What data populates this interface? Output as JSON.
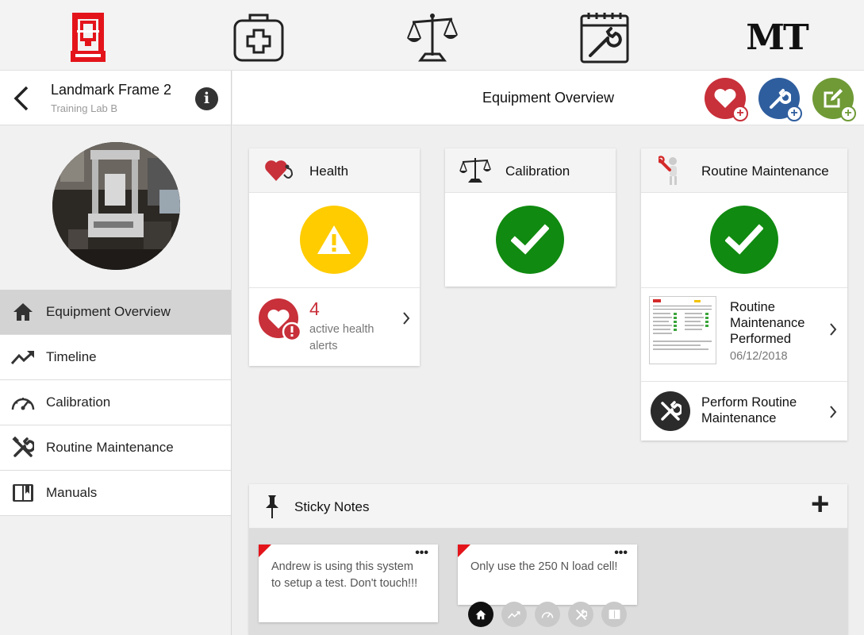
{
  "topbar": {
    "icons": [
      "frame-machine-icon",
      "first-aid-kit-icon",
      "balance-scale-icon",
      "calendar-wrench-icon"
    ],
    "logo_text": "MT"
  },
  "sidebar": {
    "title": "Landmark Frame 2",
    "subtitle": "Training Lab B",
    "info_glyph": "i",
    "nav": [
      {
        "label": "Equipment Overview",
        "icon": "home-icon",
        "active": true
      },
      {
        "label": "Timeline",
        "icon": "trend-icon"
      },
      {
        "label": "Calibration",
        "icon": "gauge-icon"
      },
      {
        "label": "Routine Maintenance",
        "icon": "tools-icon"
      },
      {
        "label": "Manuals",
        "icon": "book-icon"
      }
    ]
  },
  "header": {
    "title": "Equipment Overview",
    "colors": {
      "health": "#c8303a",
      "maintenance": "#2f5e9e",
      "edit": "#6f9a36"
    }
  },
  "health": {
    "title": "Health",
    "status": "warning",
    "status_color": "#ffcc00",
    "alert_count": "4",
    "alert_text": "active health alerts"
  },
  "calibration": {
    "title": "Calibration",
    "status": "ok",
    "status_color": "#108a10"
  },
  "maintenance": {
    "title": "Routine Maintenance",
    "status": "ok",
    "status_color": "#108a10",
    "performed_label": "Routine Maintenance Performed",
    "performed_date": "06/12/2018",
    "perform_label": "Perform Routine Maintenance"
  },
  "sticky_notes": {
    "title": "Sticky Notes",
    "add_glyph": "+",
    "more_glyph": "•••",
    "notes": [
      {
        "text": "Andrew is using this system to setup a test. Don't touch!!!"
      },
      {
        "text": "Only use the 250 N load cell!"
      }
    ]
  },
  "pager": {
    "items": [
      "home-icon",
      "trend-icon",
      "gauge-icon",
      "tools-icon",
      "book-icon"
    ],
    "active_index": 0
  }
}
